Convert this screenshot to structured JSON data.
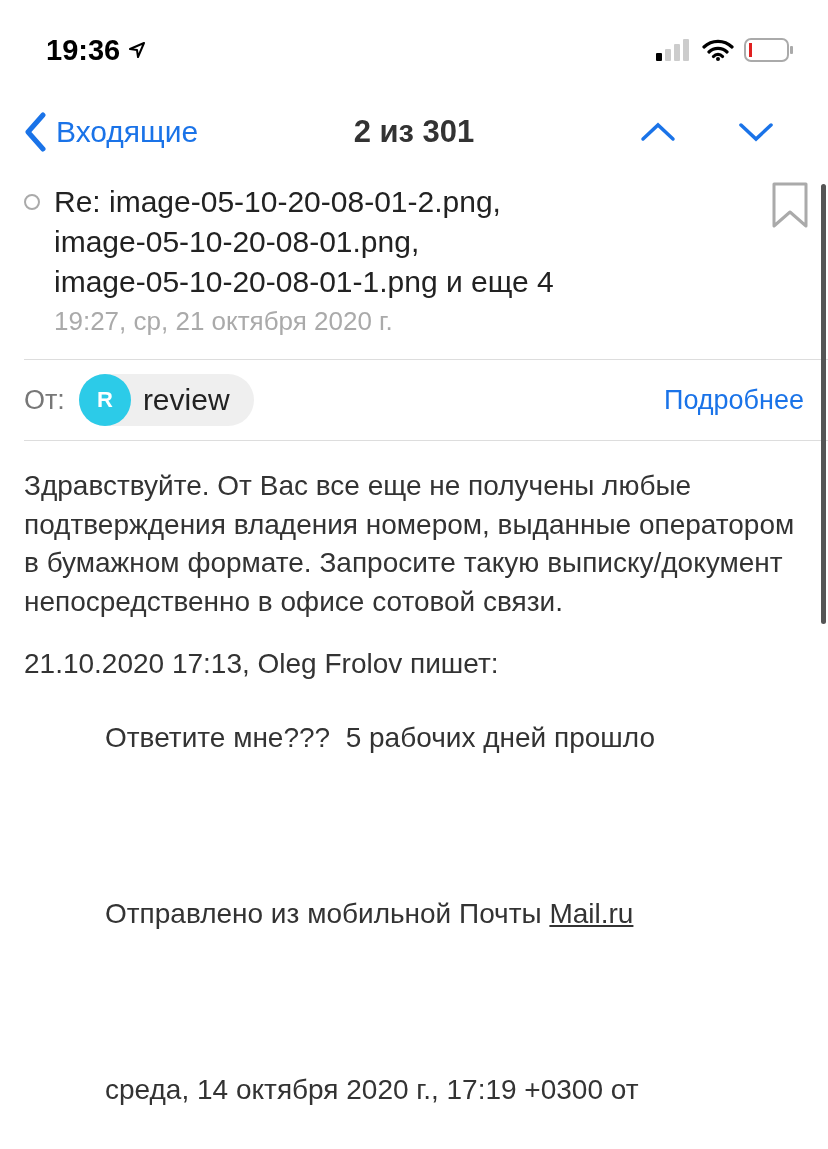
{
  "status_bar": {
    "time": "19:36"
  },
  "nav": {
    "back": "Входящие",
    "title": "2 из 301"
  },
  "message": {
    "unread": false,
    "flagged": false,
    "subject_lines": [
      "Re: image-05-10-20-08-01-2.png,",
      "image-05-10-20-08-01.png,",
      "image-05-10-20-08-01-1.png и еще 4"
    ],
    "date": "19:27, ср, 21 октября 2020 г.",
    "from_label": "От:",
    "sender": {
      "initial": "R",
      "name": "review",
      "color": "#2ccbe8"
    },
    "details": "Подробнее",
    "body": "Здравствуйте. От Вас все еще не получены любые подтверждения владения номером, выданные оператором в бумажном формате. Запросите такую выписку/документ непосредственно в офисе сотовой связи.",
    "quote_header": "21.10.2020 17:13, Oleg Frolov пишет:",
    "quote": [
      {
        "kind": "text",
        "text": "Ответите мне???  5 рабочих дней прошло"
      },
      {
        "kind": "signature",
        "text": "Отправлено из мобильной Почты ",
        "link": "Mail.ru"
      },
      {
        "kind": "text",
        "text": "среда, 14 октября 2020 г., 17:19 +0300 от"
      }
    ]
  }
}
